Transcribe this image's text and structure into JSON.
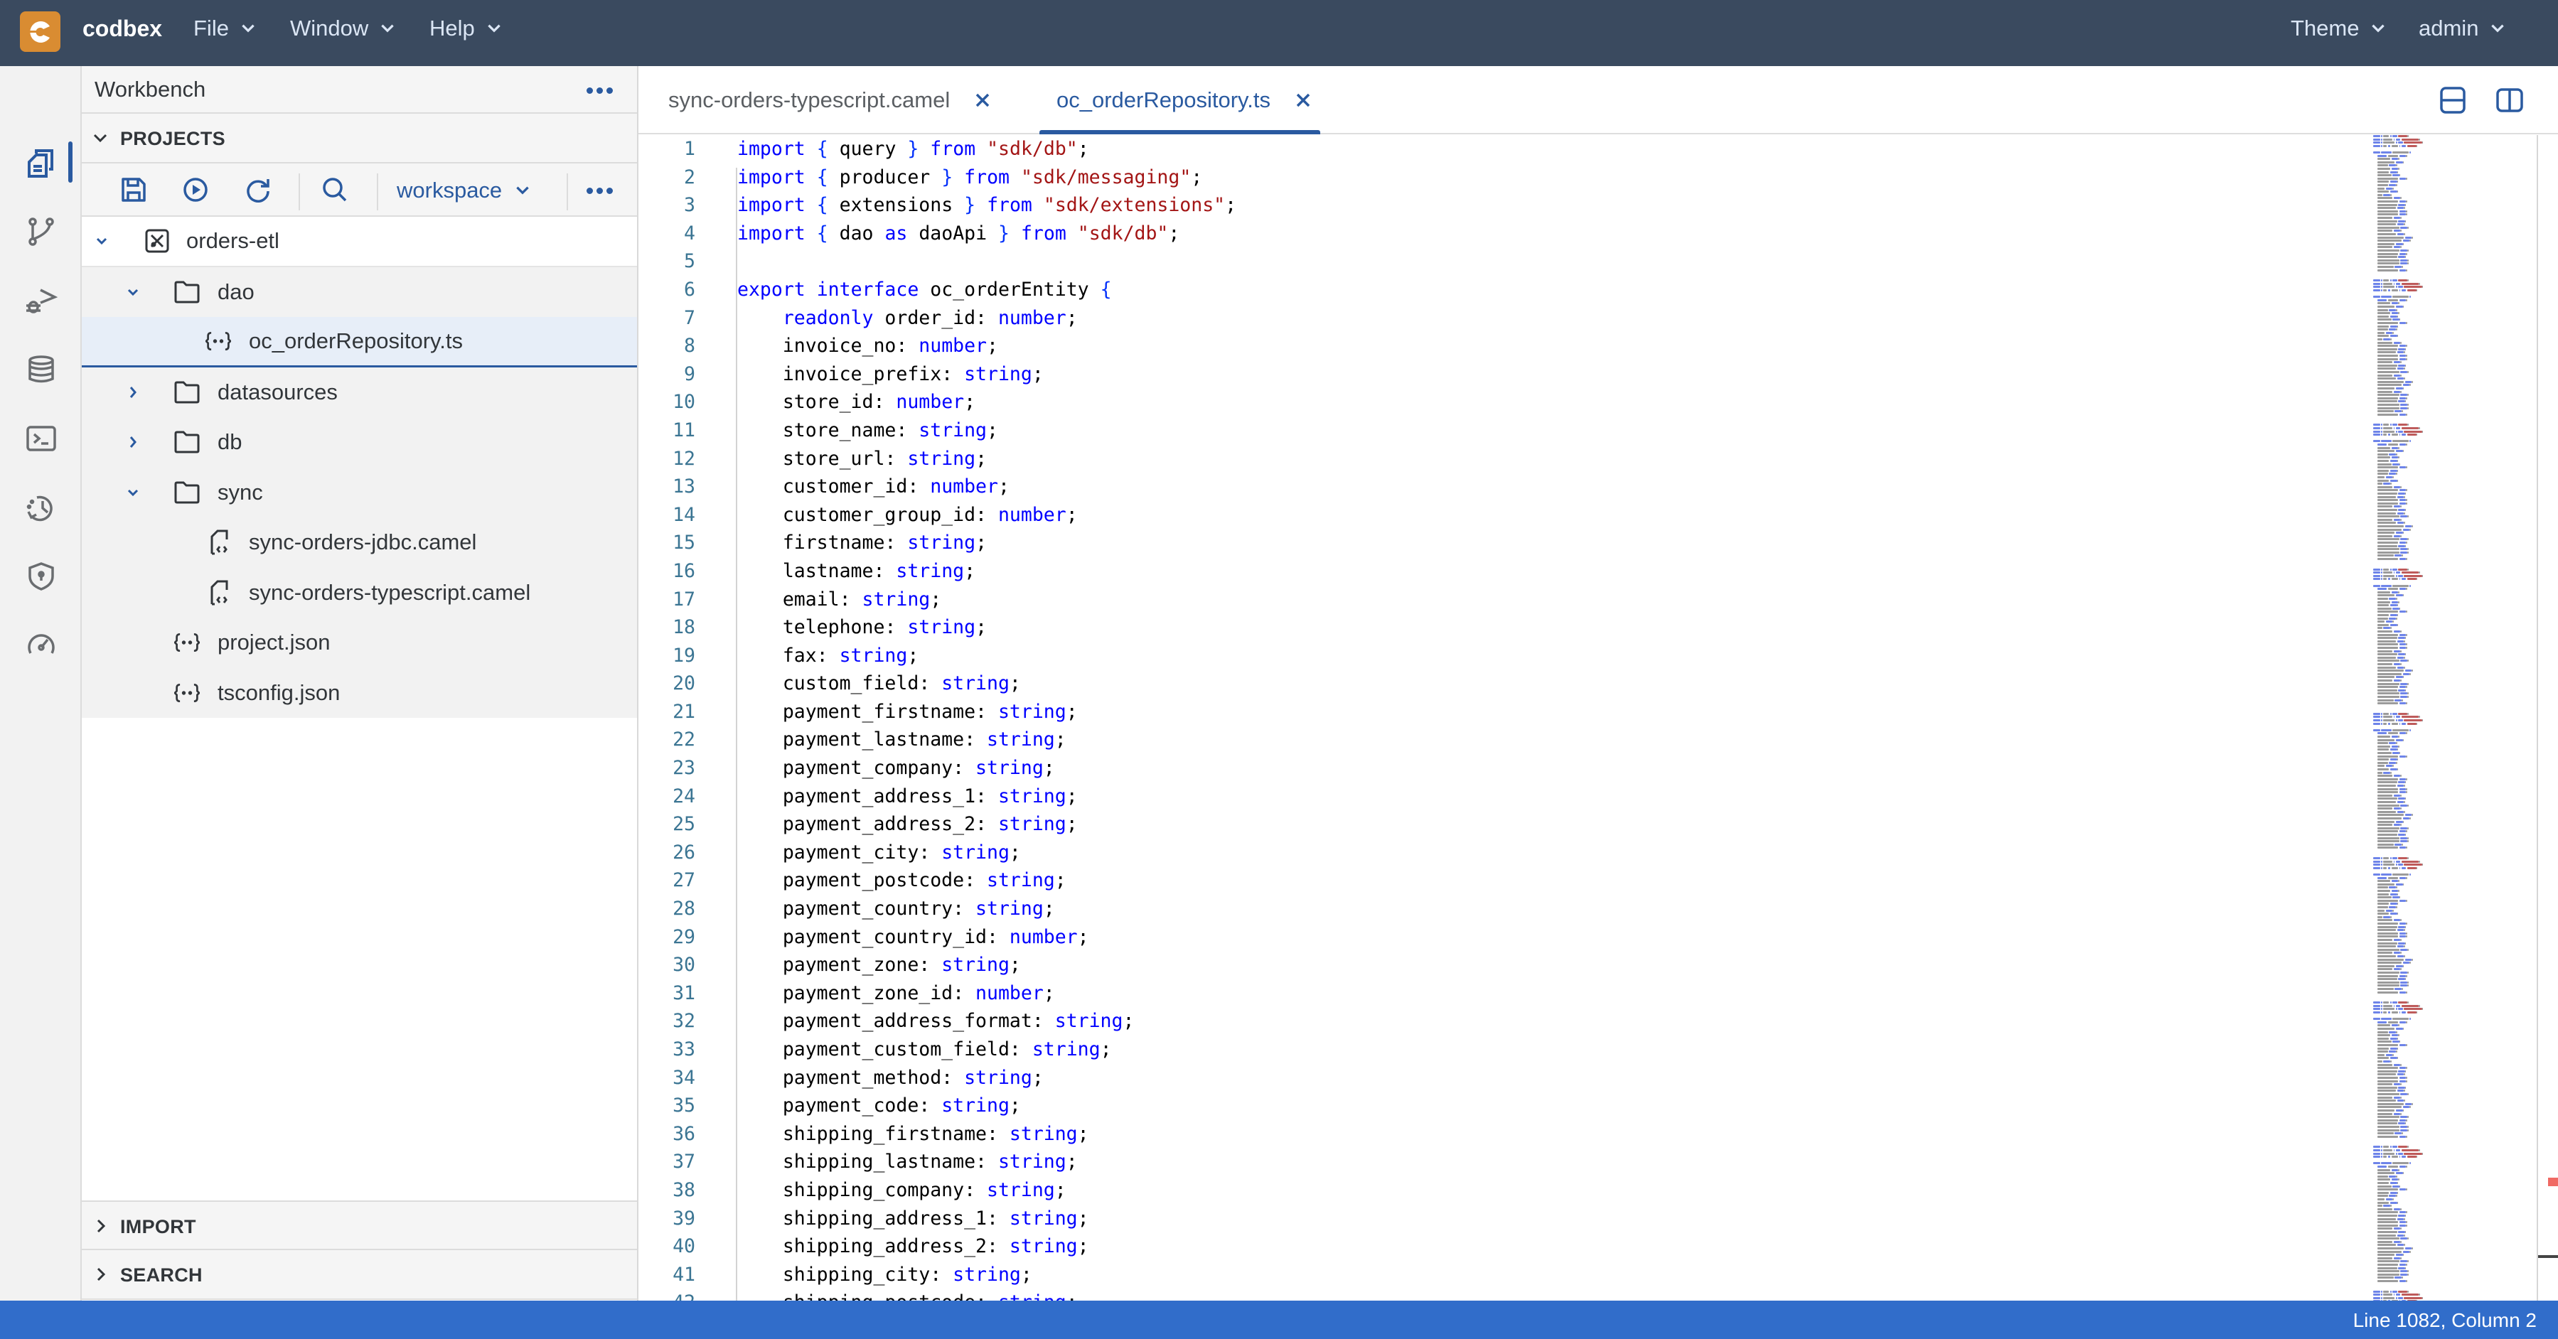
{
  "header": {
    "brand": "codbex",
    "logo_icon": "codbex-logo-icon",
    "menus": [
      "File",
      "Window",
      "Help"
    ],
    "theme_label": "Theme",
    "user_label": "admin",
    "colors": {
      "background": "#3a4a5f",
      "logo": "#d98c32"
    }
  },
  "activity_bar": {
    "items": [
      {
        "name": "workbench",
        "icon": "files-icon",
        "active": true
      },
      {
        "name": "git",
        "icon": "git-branch-icon",
        "active": false
      },
      {
        "name": "debugger",
        "icon": "debug-icon",
        "active": false
      },
      {
        "name": "database",
        "icon": "database-icon",
        "active": false
      },
      {
        "name": "terminal",
        "icon": "terminal-icon",
        "active": false
      },
      {
        "name": "history",
        "icon": "history-icon",
        "active": false
      },
      {
        "name": "security",
        "icon": "shield-icon",
        "active": false
      },
      {
        "name": "operations",
        "icon": "gauge-icon",
        "active": false
      }
    ]
  },
  "sidebar": {
    "title": "Workbench",
    "projects_header": "PROJECTS",
    "toolbar": {
      "save": "save-icon",
      "publish": "play-icon",
      "refresh": "refresh-icon",
      "search": "search-icon",
      "workspace": "workspace"
    },
    "tree": [
      {
        "name": "orders-etl",
        "type": "project",
        "level": 0,
        "expanded": true
      },
      {
        "name": "dao",
        "type": "folder",
        "level": 1,
        "expanded": true
      },
      {
        "name": "oc_orderRepository.ts",
        "type": "file-code",
        "level": 2,
        "selected": true
      },
      {
        "name": "datasources",
        "type": "folder",
        "level": 1,
        "expanded": false
      },
      {
        "name": "db",
        "type": "folder",
        "level": 1,
        "expanded": false
      },
      {
        "name": "sync",
        "type": "folder",
        "level": 1,
        "expanded": true
      },
      {
        "name": "sync-orders-jdbc.camel",
        "type": "file-camel",
        "level": 2
      },
      {
        "name": "sync-orders-typescript.camel",
        "type": "file-camel",
        "level": 2
      },
      {
        "name": "project.json",
        "type": "file-code",
        "level": 1
      },
      {
        "name": "tsconfig.json",
        "type": "file-code",
        "level": 1
      }
    ],
    "collapsed_sections": [
      "IMPORT",
      "SEARCH"
    ]
  },
  "editor": {
    "tabs": [
      {
        "label": "sync-orders-typescript.camel",
        "active": false
      },
      {
        "label": "oc_orderRepository.ts",
        "active": true
      }
    ],
    "lines": [
      [
        [
          "kw",
          "import"
        ],
        [
          "t",
          " "
        ],
        [
          "br",
          "{"
        ],
        [
          "t",
          " query "
        ],
        [
          "br",
          "}"
        ],
        [
          "t",
          " "
        ],
        [
          "kw",
          "from"
        ],
        [
          "t",
          " "
        ],
        [
          "str",
          "\"sdk/db\""
        ],
        [
          "t",
          ";"
        ]
      ],
      [
        [
          "kw",
          "import"
        ],
        [
          "t",
          " "
        ],
        [
          "br",
          "{"
        ],
        [
          "t",
          " producer "
        ],
        [
          "br",
          "}"
        ],
        [
          "t",
          " "
        ],
        [
          "kw",
          "from"
        ],
        [
          "t",
          " "
        ],
        [
          "str",
          "\"sdk/messaging\""
        ],
        [
          "t",
          ";"
        ]
      ],
      [
        [
          "kw",
          "import"
        ],
        [
          "t",
          " "
        ],
        [
          "br",
          "{"
        ],
        [
          "t",
          " extensions "
        ],
        [
          "br",
          "}"
        ],
        [
          "t",
          " "
        ],
        [
          "kw",
          "from"
        ],
        [
          "t",
          " "
        ],
        [
          "str",
          "\"sdk/extensions\""
        ],
        [
          "t",
          ";"
        ]
      ],
      [
        [
          "kw",
          "import"
        ],
        [
          "t",
          " "
        ],
        [
          "br",
          "{"
        ],
        [
          "t",
          " dao "
        ],
        [
          "kw",
          "as"
        ],
        [
          "t",
          " daoApi "
        ],
        [
          "br",
          "}"
        ],
        [
          "t",
          " "
        ],
        [
          "kw",
          "from"
        ],
        [
          "t",
          " "
        ],
        [
          "str",
          "\"sdk/db\""
        ],
        [
          "t",
          ";"
        ]
      ],
      [],
      [
        [
          "kw",
          "export"
        ],
        [
          "t",
          " "
        ],
        [
          "kw",
          "interface"
        ],
        [
          "t",
          " oc_orderEntity "
        ],
        [
          "br",
          "{"
        ]
      ],
      [
        [
          "t",
          "    "
        ],
        [
          "kw",
          "readonly"
        ],
        [
          "t",
          " order_id: "
        ],
        [
          "ty",
          "number"
        ],
        [
          "t",
          ";"
        ]
      ],
      [
        [
          "t",
          "    invoice_no: "
        ],
        [
          "ty",
          "number"
        ],
        [
          "t",
          ";"
        ]
      ],
      [
        [
          "t",
          "    invoice_prefix: "
        ],
        [
          "ty",
          "string"
        ],
        [
          "t",
          ";"
        ]
      ],
      [
        [
          "t",
          "    store_id: "
        ],
        [
          "ty",
          "number"
        ],
        [
          "t",
          ";"
        ]
      ],
      [
        [
          "t",
          "    store_name: "
        ],
        [
          "ty",
          "string"
        ],
        [
          "t",
          ";"
        ]
      ],
      [
        [
          "t",
          "    store_url: "
        ],
        [
          "ty",
          "string"
        ],
        [
          "t",
          ";"
        ]
      ],
      [
        [
          "t",
          "    customer_id: "
        ],
        [
          "ty",
          "number"
        ],
        [
          "t",
          ";"
        ]
      ],
      [
        [
          "t",
          "    customer_group_id: "
        ],
        [
          "ty",
          "number"
        ],
        [
          "t",
          ";"
        ]
      ],
      [
        [
          "t",
          "    firstname: "
        ],
        [
          "ty",
          "string"
        ],
        [
          "t",
          ";"
        ]
      ],
      [
        [
          "t",
          "    lastname: "
        ],
        [
          "ty",
          "string"
        ],
        [
          "t",
          ";"
        ]
      ],
      [
        [
          "t",
          "    email: "
        ],
        [
          "ty",
          "string"
        ],
        [
          "t",
          ";"
        ]
      ],
      [
        [
          "t",
          "    telephone: "
        ],
        [
          "ty",
          "string"
        ],
        [
          "t",
          ";"
        ]
      ],
      [
        [
          "t",
          "    fax: "
        ],
        [
          "ty",
          "string"
        ],
        [
          "t",
          ";"
        ]
      ],
      [
        [
          "t",
          "    custom_field: "
        ],
        [
          "ty",
          "string"
        ],
        [
          "t",
          ";"
        ]
      ],
      [
        [
          "t",
          "    payment_firstname: "
        ],
        [
          "ty",
          "string"
        ],
        [
          "t",
          ";"
        ]
      ],
      [
        [
          "t",
          "    payment_lastname: "
        ],
        [
          "ty",
          "string"
        ],
        [
          "t",
          ";"
        ]
      ],
      [
        [
          "t",
          "    payment_company: "
        ],
        [
          "ty",
          "string"
        ],
        [
          "t",
          ";"
        ]
      ],
      [
        [
          "t",
          "    payment_address_1: "
        ],
        [
          "ty",
          "string"
        ],
        [
          "t",
          ";"
        ]
      ],
      [
        [
          "t",
          "    payment_address_2: "
        ],
        [
          "ty",
          "string"
        ],
        [
          "t",
          ";"
        ]
      ],
      [
        [
          "t",
          "    payment_city: "
        ],
        [
          "ty",
          "string"
        ],
        [
          "t",
          ";"
        ]
      ],
      [
        [
          "t",
          "    payment_postcode: "
        ],
        [
          "ty",
          "string"
        ],
        [
          "t",
          ";"
        ]
      ],
      [
        [
          "t",
          "    payment_country: "
        ],
        [
          "ty",
          "string"
        ],
        [
          "t",
          ";"
        ]
      ],
      [
        [
          "t",
          "    payment_country_id: "
        ],
        [
          "ty",
          "number"
        ],
        [
          "t",
          ";"
        ]
      ],
      [
        [
          "t",
          "    payment_zone: "
        ],
        [
          "ty",
          "string"
        ],
        [
          "t",
          ";"
        ]
      ],
      [
        [
          "t",
          "    payment_zone_id: "
        ],
        [
          "ty",
          "number"
        ],
        [
          "t",
          ";"
        ]
      ],
      [
        [
          "t",
          "    payment_address_format: "
        ],
        [
          "ty",
          "string"
        ],
        [
          "t",
          ";"
        ]
      ],
      [
        [
          "t",
          "    payment_custom_field: "
        ],
        [
          "ty",
          "string"
        ],
        [
          "t",
          ";"
        ]
      ],
      [
        [
          "t",
          "    payment_method: "
        ],
        [
          "ty",
          "string"
        ],
        [
          "t",
          ";"
        ]
      ],
      [
        [
          "t",
          "    payment_code: "
        ],
        [
          "ty",
          "string"
        ],
        [
          "t",
          ";"
        ]
      ],
      [
        [
          "t",
          "    shipping_firstname: "
        ],
        [
          "ty",
          "string"
        ],
        [
          "t",
          ";"
        ]
      ],
      [
        [
          "t",
          "    shipping_lastname: "
        ],
        [
          "ty",
          "string"
        ],
        [
          "t",
          ";"
        ]
      ],
      [
        [
          "t",
          "    shipping_company: "
        ],
        [
          "ty",
          "string"
        ],
        [
          "t",
          ";"
        ]
      ],
      [
        [
          "t",
          "    shipping_address_1: "
        ],
        [
          "ty",
          "string"
        ],
        [
          "t",
          ";"
        ]
      ],
      [
        [
          "t",
          "    shipping_address_2: "
        ],
        [
          "ty",
          "string"
        ],
        [
          "t",
          ";"
        ]
      ],
      [
        [
          "t",
          "    shipping_city: "
        ],
        [
          "ty",
          "string"
        ],
        [
          "t",
          ";"
        ]
      ],
      [
        [
          "t",
          "    shipping_postcode: "
        ],
        [
          "ty",
          "string"
        ],
        [
          "t",
          ";"
        ]
      ]
    ]
  },
  "status_bar": {
    "cursor_position": "Line 1082, Column 2",
    "color": "#316dca"
  }
}
